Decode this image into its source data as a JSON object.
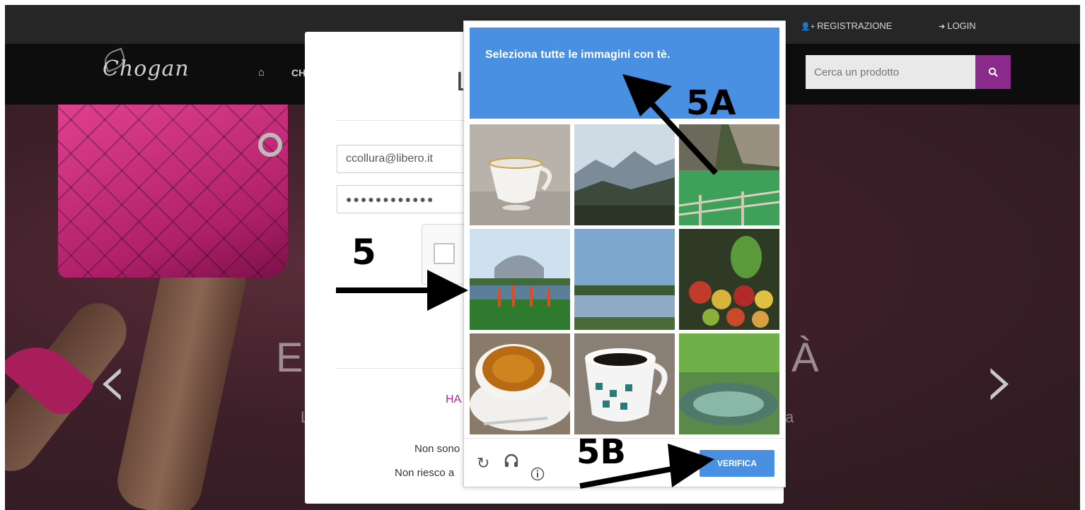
{
  "topbar": {
    "register_label": "REGISTRAZIONE",
    "login_label": "LOGIN",
    "register_icon": "user-plus-icon",
    "login_icon": "sign-in-icon"
  },
  "navbar": {
    "logo_text": "Chogan",
    "nav_fragment": "CH",
    "search_placeholder": "Cerca un prodotto",
    "search_icon": "search-icon",
    "accent_color": "#8a2a8a"
  },
  "hero": {
    "left_text": "E",
    "right_text": "À",
    "sub_left": "L",
    "sub_right": "a"
  },
  "login_modal": {
    "title_fragment": "L",
    "email_value": "ccollura@libero.it",
    "password_mask": "●●●●●●●●●●●●",
    "link_fragment": "HA",
    "line1": "Non sono",
    "line2": "Non riesco a",
    "link_color": "#b91f9e"
  },
  "captcha": {
    "instruction_prefix": "Seleziona tutte le immagini con",
    "instruction_target": "tè",
    "instruction_suffix": ".",
    "header_color": "#4a90e2",
    "tiles": [
      {
        "label": "teacup"
      },
      {
        "label": "mountains"
      },
      {
        "label": "green lake"
      },
      {
        "label": "garden building"
      },
      {
        "label": "lake"
      },
      {
        "label": "fruit display"
      },
      {
        "label": "cup of tea"
      },
      {
        "label": "coffee cup"
      },
      {
        "label": "pond"
      }
    ],
    "reload_icon": "reload-icon",
    "audio_icon": "headphones-icon",
    "info_icon": "info-icon",
    "verify_label": "VERIFICA"
  },
  "annotations": {
    "label_5": "5",
    "label_5a": "5A",
    "label_5b": "5B"
  }
}
